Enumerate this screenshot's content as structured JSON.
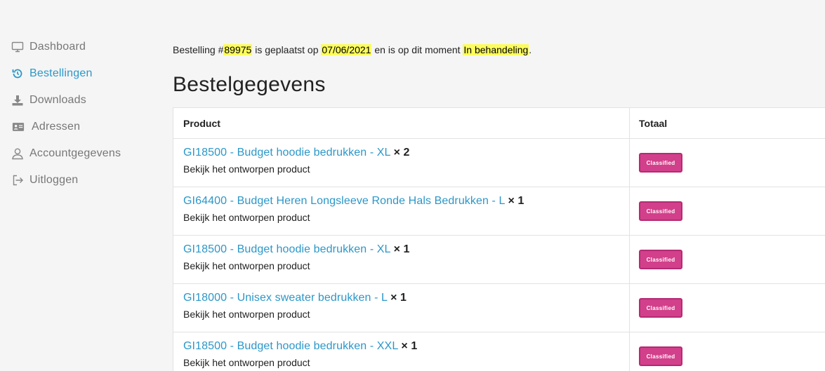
{
  "sidebar": {
    "items": [
      {
        "label": "Dashboard",
        "icon": "monitor-icon",
        "active": false
      },
      {
        "label": "Bestellingen",
        "icon": "history-icon",
        "active": true
      },
      {
        "label": "Downloads",
        "icon": "download-icon",
        "active": false
      },
      {
        "label": "Adressen",
        "icon": "address-card-icon",
        "active": false
      },
      {
        "label": "Accountgegevens",
        "icon": "user-icon",
        "active": false
      },
      {
        "label": "Uitloggen",
        "icon": "logout-icon",
        "active": false
      }
    ]
  },
  "notice": {
    "prefix": "Bestelling #",
    "order_number": "89975",
    "placed_text": " is geplaatst op ",
    "date": "07/06/2021",
    "status_text": " en is op dit moment ",
    "status": "In behandeling",
    "suffix": "."
  },
  "heading": "Bestelgegevens",
  "table": {
    "headers": {
      "product": "Product",
      "total": "Totaal"
    },
    "rows": [
      {
        "product": "GI18500 - Budget hoodie bedrukken - XL",
        "qty": "× 2",
        "sub": "Bekijk het ontworpen product",
        "total_badge": "Classified"
      },
      {
        "product": "GI64400 - Budget Heren Longsleeve Ronde Hals Bedrukken - L",
        "qty": "× 1",
        "sub": "Bekijk het ontworpen product",
        "total_badge": "Classified"
      },
      {
        "product": "GI18500 - Budget hoodie bedrukken - XL",
        "qty": "× 1",
        "sub": "Bekijk het ontworpen product",
        "total_badge": "Classified"
      },
      {
        "product": "GI18000 - Unisex sweater bedrukken - L",
        "qty": "× 1",
        "sub": "Bekijk het ontworpen product",
        "total_badge": "Classified"
      },
      {
        "product": "GI18500 - Budget hoodie bedrukken - XXL",
        "qty": "× 1",
        "sub": "Bekijk het ontworpen product",
        "total_badge": "Classified"
      }
    ]
  },
  "colors": {
    "accent": "#2b97c9",
    "highlight": "#fcfc5c",
    "badge": "#d23f8a"
  }
}
